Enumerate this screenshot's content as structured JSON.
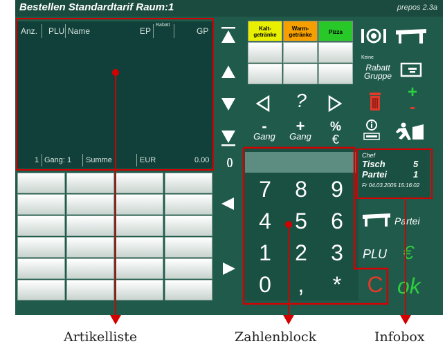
{
  "app": {
    "title": "Bestellen  Standardtarif  Raum:1",
    "version": "prepos 2.3a"
  },
  "article_list": {
    "columns": [
      "Anz.",
      "PLU",
      "Name",
      "EP",
      "Rabatt",
      "GP"
    ],
    "summary": {
      "count": "1",
      "gang": "Gang: 1",
      "label": "Summe",
      "currency": "EUR",
      "total": "0.00"
    }
  },
  "categories": [
    {
      "label": "Kalt-\ngetränke",
      "color": "#e8f000"
    },
    {
      "label": "Warm-\ngetränke",
      "color": "#f5a000"
    },
    {
      "label": "Pizza",
      "color": "#28c828"
    }
  ],
  "controls": {
    "help": "?",
    "gang_minus": "Gang",
    "gang_plus": "Gang",
    "percent": "%",
    "euro_small": "€",
    "rabatt_group_small": "Keine",
    "rabatt_group": "Rabatt\nGruppe",
    "partei": "Partei",
    "plu": "PLU",
    "euro": "€",
    "ok": "ok",
    "clear": "C",
    "paren": "()"
  },
  "numpad": {
    "keys": [
      "7",
      "8",
      "9",
      "4",
      "5",
      "6",
      "1",
      "2",
      "3",
      "0",
      ",",
      "*"
    ]
  },
  "infobox": {
    "user": "Chef",
    "table_label": "Tisch",
    "table_number": "5",
    "party_label": "Partei",
    "party_number": "1",
    "datetime": "Fr 04.03.2005 15:16:02"
  },
  "captions": {
    "article_list": "Artikelliste",
    "numpad": "Zahlenblock",
    "infobox": "Infobox"
  },
  "colors": {
    "background": "#1f5a4b",
    "list_background": "#11403a",
    "annotation": "#d40000",
    "ok": "#2ecc40",
    "clear": "#e23a2a"
  }
}
